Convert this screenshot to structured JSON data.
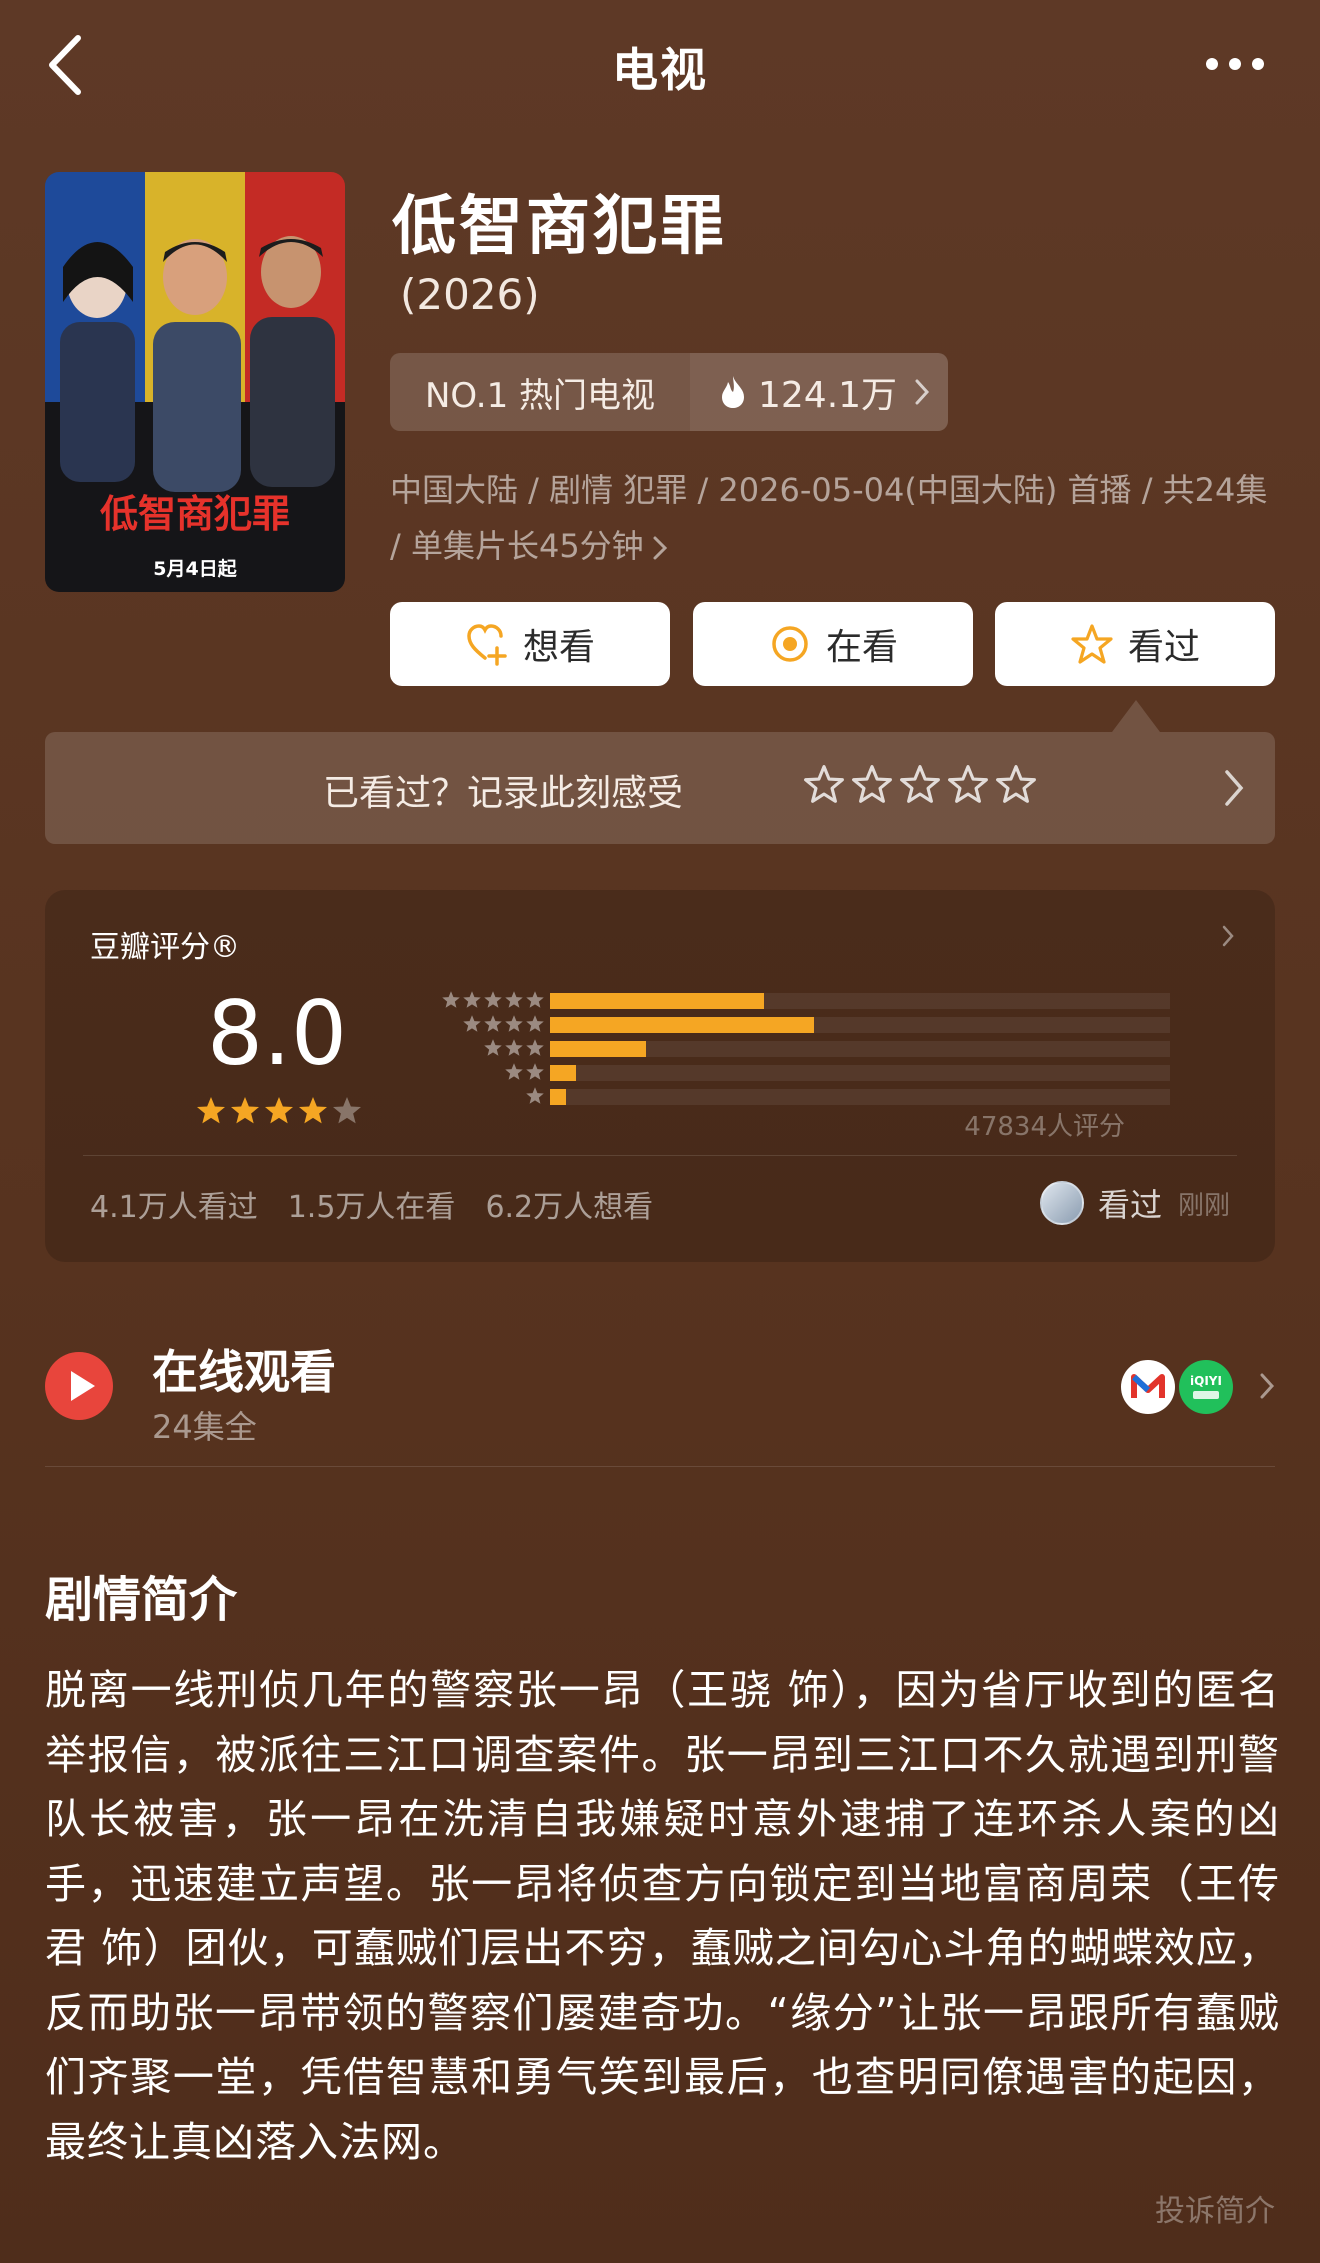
{
  "topbar": {
    "title": "电视"
  },
  "colors": {
    "accent": "#f5a623",
    "background": "#5a3624",
    "play_red": "#e8453c"
  },
  "poster": {
    "title_art": "低智商犯罪",
    "date_caption": "5月4日起"
  },
  "show": {
    "title": "低智商犯罪",
    "year": "(2026)",
    "rank_label": "NO.1 热门电视",
    "heat": "124.1万",
    "meta": "中国大陆 / 剧情 犯罪 / 2026-05-04(中国大陆) 首播 / 共24集 / 单集片长45分钟"
  },
  "actions": {
    "want": "想看",
    "watching": "在看",
    "watched": "看过"
  },
  "record": {
    "prompt": "已看过？记录此刻感受"
  },
  "rating": {
    "title": "豆瓣评分®",
    "score": "8.0",
    "stars_filled": 4,
    "stars_total": 5,
    "distribution": [
      {
        "stars": 5,
        "fraction": 0.345
      },
      {
        "stars": 4,
        "fraction": 0.425
      },
      {
        "stars": 3,
        "fraction": 0.155
      },
      {
        "stars": 2,
        "fraction": 0.042
      },
      {
        "stars": 1,
        "fraction": 0.025
      }
    ],
    "count_label": "47834人评分",
    "stats": [
      "4.1万人看过",
      "1.5万人在看",
      "6.2万人想看"
    ],
    "friend_status": "看过",
    "friend_time": "刚刚"
  },
  "online": {
    "title": "在线观看",
    "subtitle": "24集全",
    "platforms": [
      "mango-tv-icon",
      "iqiyi-icon"
    ]
  },
  "synopsis": {
    "title": "剧情简介",
    "body": "脱离一线刑侦几年的警察张一昂（王骁 饰），因为省厅收到的匿名举报信，被派往三江口调查案件。张一昂到三江口不久就遇到刑警队长被害，张一昂在洗清自我嫌疑时意外逮捕了连环杀人案的凶手，迅速建立声望。张一昂将侦查方向锁定到当地富商周荣（王传君 饰）团伙，可蠢贼们层出不穷，蠢贼之间勾心斗角的蝴蝶效应，反而助张一昂带领的警察们屡建奇功。“缘分”让张一昂跟所有蠢贼们齐聚一堂，凭借智慧和勇气笑到最后，也查明同僚遇害的起因，最终让真凶落入法网。",
    "report_link": "投诉简介"
  }
}
